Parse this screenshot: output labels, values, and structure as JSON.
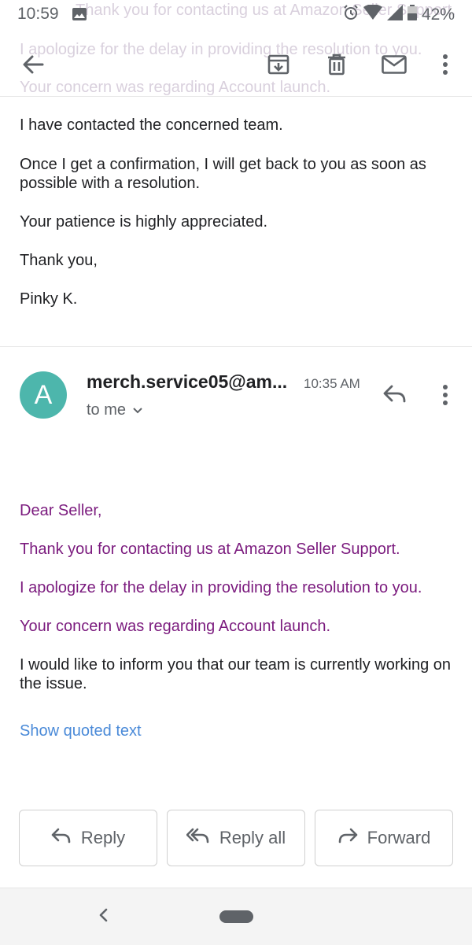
{
  "background_text": {
    "line1": "Thank you for contacting us at Amazon Seller Support.",
    "line2": "I apologize for the delay in providing the resolution to you.",
    "line3": "Your concern was regarding Account launch."
  },
  "status_bar": {
    "time": "10:59",
    "battery": "42%"
  },
  "icons": {
    "back": "arrow-left-icon",
    "archive": "archive-icon",
    "delete": "trash-icon",
    "mark_unread": "envelope-icon",
    "more": "more-vertical-icon"
  },
  "previous_message": {
    "p1": "I have contacted the concerned team.",
    "p2": "Once I get a confirmation, I will get back to you as soon as possible with a resolution.",
    "p3": "Your patience is highly appreciated.",
    "p4": "Thank you,",
    "p5": "Pinky K."
  },
  "message": {
    "avatar_letter": "A",
    "avatar_color": "#4db6ac",
    "sender": "merch.service05@am...",
    "time": "10:35 AM",
    "recipient": "to me",
    "greeting": "Dear Seller,",
    "line1": "Thank you for contacting us at Amazon Seller Support.",
    "line2": "I apologize for the delay in providing the resolution to you.",
    "line3": "Your concern was regarding Account launch.",
    "line4": "I would like to inform you that our team is currently working on the issue.",
    "show_quoted": "Show quoted text",
    "text_color": "#7b1b7e"
  },
  "actions": {
    "reply": "Reply",
    "reply_all": "Reply all",
    "forward": "Forward"
  }
}
